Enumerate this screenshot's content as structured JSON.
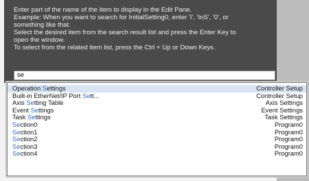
{
  "help": {
    "lines": [
      "Enter part of the name of the item to display in the Edit Pane.",
      "Example: When you want to search for InitialSetting0, enter 'I', 'InS', '0', or",
      "something like that.",
      "Select the desired item from the search result list and press the Enter Key to",
      "open the window.",
      "To select from the related item list, press the Ctrl + Up or Down Keys."
    ]
  },
  "search": {
    "value": "se"
  },
  "results": [
    {
      "pre": "Operation ",
      "match": "S",
      "post": "ettings",
      "category": "Controller Setup"
    },
    {
      "pre": "Built-in EtherNet/IP Port ",
      "match": "Se",
      "post": "tt...",
      "category": "Controller Setup"
    },
    {
      "pre": "Axis ",
      "match": "Se",
      "post": "tting Table",
      "category": "Axis Settings"
    },
    {
      "pre": "Event ",
      "match": "Se",
      "post": "ttings",
      "category": "Event Settings"
    },
    {
      "pre": "Task ",
      "match": "Se",
      "post": "ttings",
      "category": "Task Settings"
    },
    {
      "pre": "",
      "match": "Se",
      "post": "ction0",
      "category": "Program0"
    },
    {
      "pre": "",
      "match": "Se",
      "post": "ction1",
      "category": "Program0"
    },
    {
      "pre": "",
      "match": "Se",
      "post": "ction2",
      "category": "Program0"
    },
    {
      "pre": "",
      "match": "Se",
      "post": "ction3",
      "category": "Program0"
    },
    {
      "pre": "",
      "match": "Se",
      "post": "ction4",
      "category": "Program0"
    }
  ],
  "colors": {
    "panel": "#4a4a4a",
    "match": "#2a67c9",
    "selected_row": "#d8e4f3"
  }
}
